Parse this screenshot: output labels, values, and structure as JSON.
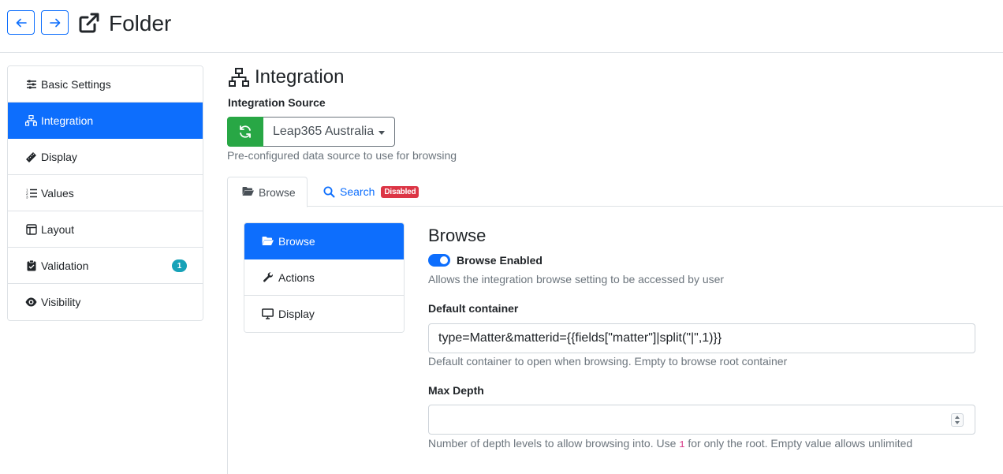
{
  "header": {
    "title": "Folder",
    "back_icon": "arrow-left-icon",
    "forward_icon": "arrow-right-icon",
    "title_icon": "external-link-icon"
  },
  "sidebar": {
    "items": [
      {
        "label": "Basic Settings",
        "icon": "sliders-icon",
        "active": false
      },
      {
        "label": "Integration",
        "icon": "network-icon",
        "active": true
      },
      {
        "label": "Display",
        "icon": "ruler-icon",
        "active": false
      },
      {
        "label": "Values",
        "icon": "list-ordered-icon",
        "active": false
      },
      {
        "label": "Layout",
        "icon": "layout-icon",
        "active": false
      },
      {
        "label": "Validation",
        "icon": "clipboard-check-icon",
        "active": false,
        "badge": "1"
      },
      {
        "label": "Visibility",
        "icon": "eye-icon",
        "active": false
      }
    ]
  },
  "main": {
    "section_title": "Integration",
    "source_label": "Integration Source",
    "source_value": "Leap365 Australia",
    "source_help": "Pre-configured data source to use for browsing",
    "tabs": [
      {
        "label": "Browse",
        "active": true
      },
      {
        "label": "Search",
        "active": false,
        "badge": "Disabled"
      }
    ],
    "inner_nav": [
      {
        "label": "Browse",
        "icon": "folder-open-icon",
        "active": true
      },
      {
        "label": "Actions",
        "icon": "wrench-icon",
        "active": false
      },
      {
        "label": "Display",
        "icon": "monitor-icon",
        "active": false
      }
    ],
    "browse": {
      "title": "Browse",
      "toggle_label": "Browse Enabled",
      "toggle_on": true,
      "toggle_help": "Allows the integration browse setting to be accessed by user",
      "container_label": "Default container",
      "container_value": "type=Matter&matterid={{fields[\"matter\"]|split(\"|\",1)}}",
      "container_help": "Default container to open when browsing. Empty to browse root container",
      "depth_label": "Max Depth",
      "depth_value": "",
      "depth_help_pre": "Number of depth levels to allow browsing into. Use ",
      "depth_help_code": "1",
      "depth_help_post": " for only the root. Empty value allows unlimited"
    }
  },
  "colors": {
    "primary": "#0d6efd",
    "success": "#28a745",
    "danger": "#dc3545",
    "info": "#17a2b8"
  }
}
